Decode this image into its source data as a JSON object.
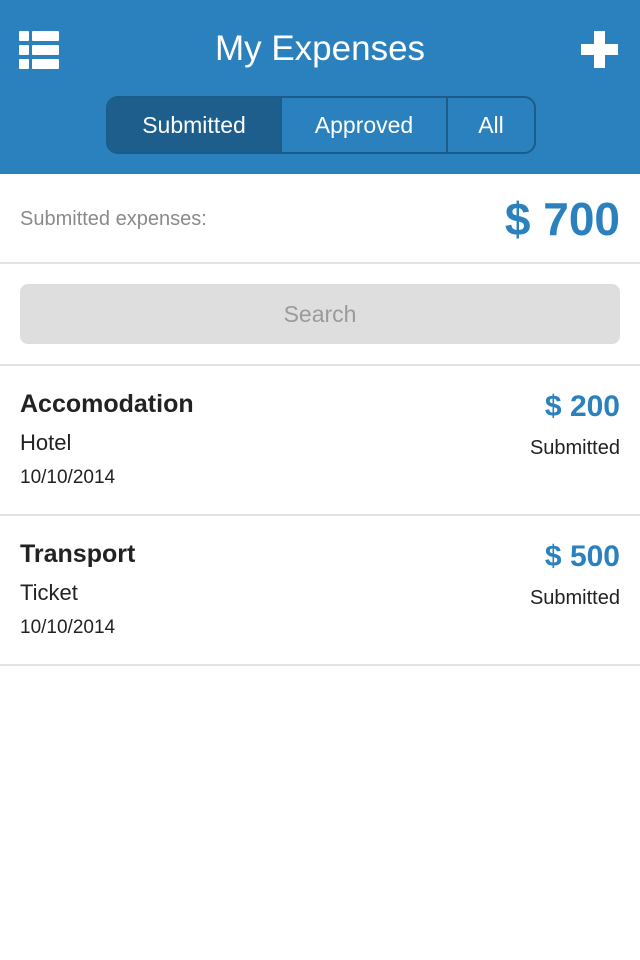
{
  "header": {
    "title": "My Expenses",
    "menu_icon": "list-icon",
    "add_icon": "plus-icon",
    "accent_color": "#2a81bd",
    "tabs": [
      {
        "label": "Submitted",
        "active": true
      },
      {
        "label": "Approved",
        "active": false
      },
      {
        "label": "All",
        "active": false
      }
    ]
  },
  "summary": {
    "label": "Submitted expenses:",
    "total": "$ 700"
  },
  "search": {
    "placeholder": "Search",
    "value": ""
  },
  "expenses": [
    {
      "name": "Accomodation",
      "type": "Hotel",
      "date": "10/10/2014",
      "amount": "$ 200",
      "status": "Submitted"
    },
    {
      "name": "Transport",
      "type": "Ticket",
      "date": "10/10/2014",
      "amount": "$ 500",
      "status": "Submitted"
    }
  ]
}
